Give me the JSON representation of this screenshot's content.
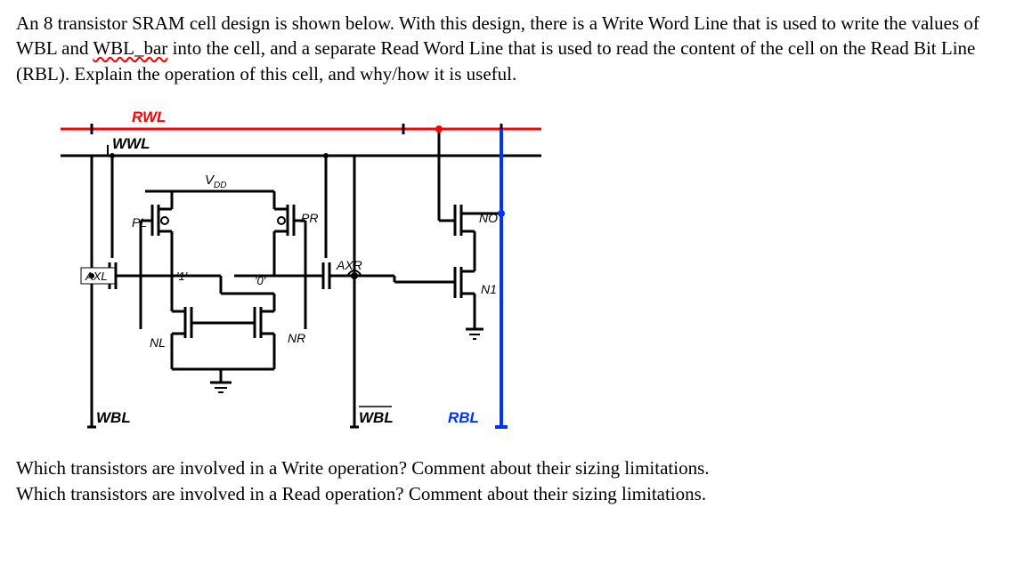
{
  "paragraph1": {
    "part1": "An 8 transistor SRAM cell design is shown below. With this design, there is a Write Word Line that is used to write the values of WBL and ",
    "wavy": "WBL_bar",
    "part2": " into the cell, and a separate Read Word Line that is used to read the content of the cell on the Read Bit Line (RBL). Explain the operation of this cell, and why/how it is useful."
  },
  "questions": {
    "q1": "Which transistors are involved in a Write operation? Comment about their sizing limitations.",
    "q2": "Which transistors are involved in a Read operation? Comment about their sizing limitations."
  },
  "diagram": {
    "labels": {
      "RWL": "RWL",
      "WWL": "WWL",
      "Voo": "V",
      "VooSub": "DD",
      "PL": "PL",
      "PR": "PR",
      "NO": "NO",
      "AXL": "AXL",
      "AXR": "AXR",
      "one": "'1'",
      "zero": "'0'",
      "N1": "N1",
      "NL": "NL",
      "NR": "NR",
      "WBL": "WBL",
      "WBLbar": "WBL",
      "RBL": "RBL"
    },
    "colors": {
      "rwl": "#ff0000",
      "wwl": "#000000",
      "rbl": "#0033ff",
      "wire": "#000000"
    }
  }
}
